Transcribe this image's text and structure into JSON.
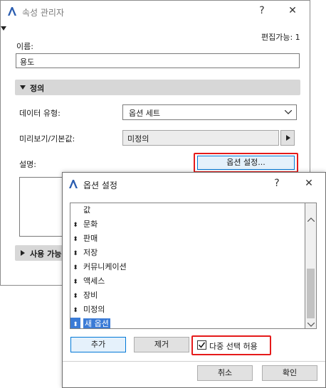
{
  "main_window": {
    "title": "속성 관리자",
    "help_glyph": "?",
    "close_glyph": "✕",
    "editable_count": "편집가능: 1",
    "name_label": "이름:",
    "name_value": "용도",
    "definition_section": "정의",
    "data_type_label": "데이터 유형:",
    "data_type_value": "옵션 세트",
    "preview_default_label": "미리보기/기본값:",
    "preview_default_value": "미정의",
    "description_label": "설명:",
    "option_settings_button": "옵션 설정...",
    "availability_section": "사용 가능"
  },
  "options_dialog": {
    "title": "옵션 설정",
    "help_glyph": "?",
    "close_glyph": "✕",
    "list_header": "값",
    "items": [
      {
        "label": "문화"
      },
      {
        "label": "판매"
      },
      {
        "label": "저장"
      },
      {
        "label": "커뮤니케이션"
      },
      {
        "label": "액세스"
      },
      {
        "label": "장비"
      },
      {
        "label": "미정의"
      },
      {
        "label": "새 옵션",
        "selected": true
      }
    ],
    "add_button": "추가",
    "remove_button": "제거",
    "multi_select_label": "다중 선택 허용",
    "multi_select_checked": true,
    "cancel_button": "취소",
    "ok_button": "확인"
  },
  "colors": {
    "highlight_red": "#e51a1a",
    "selection_blue": "#3b7bd6",
    "primary_border": "#0078d7"
  }
}
